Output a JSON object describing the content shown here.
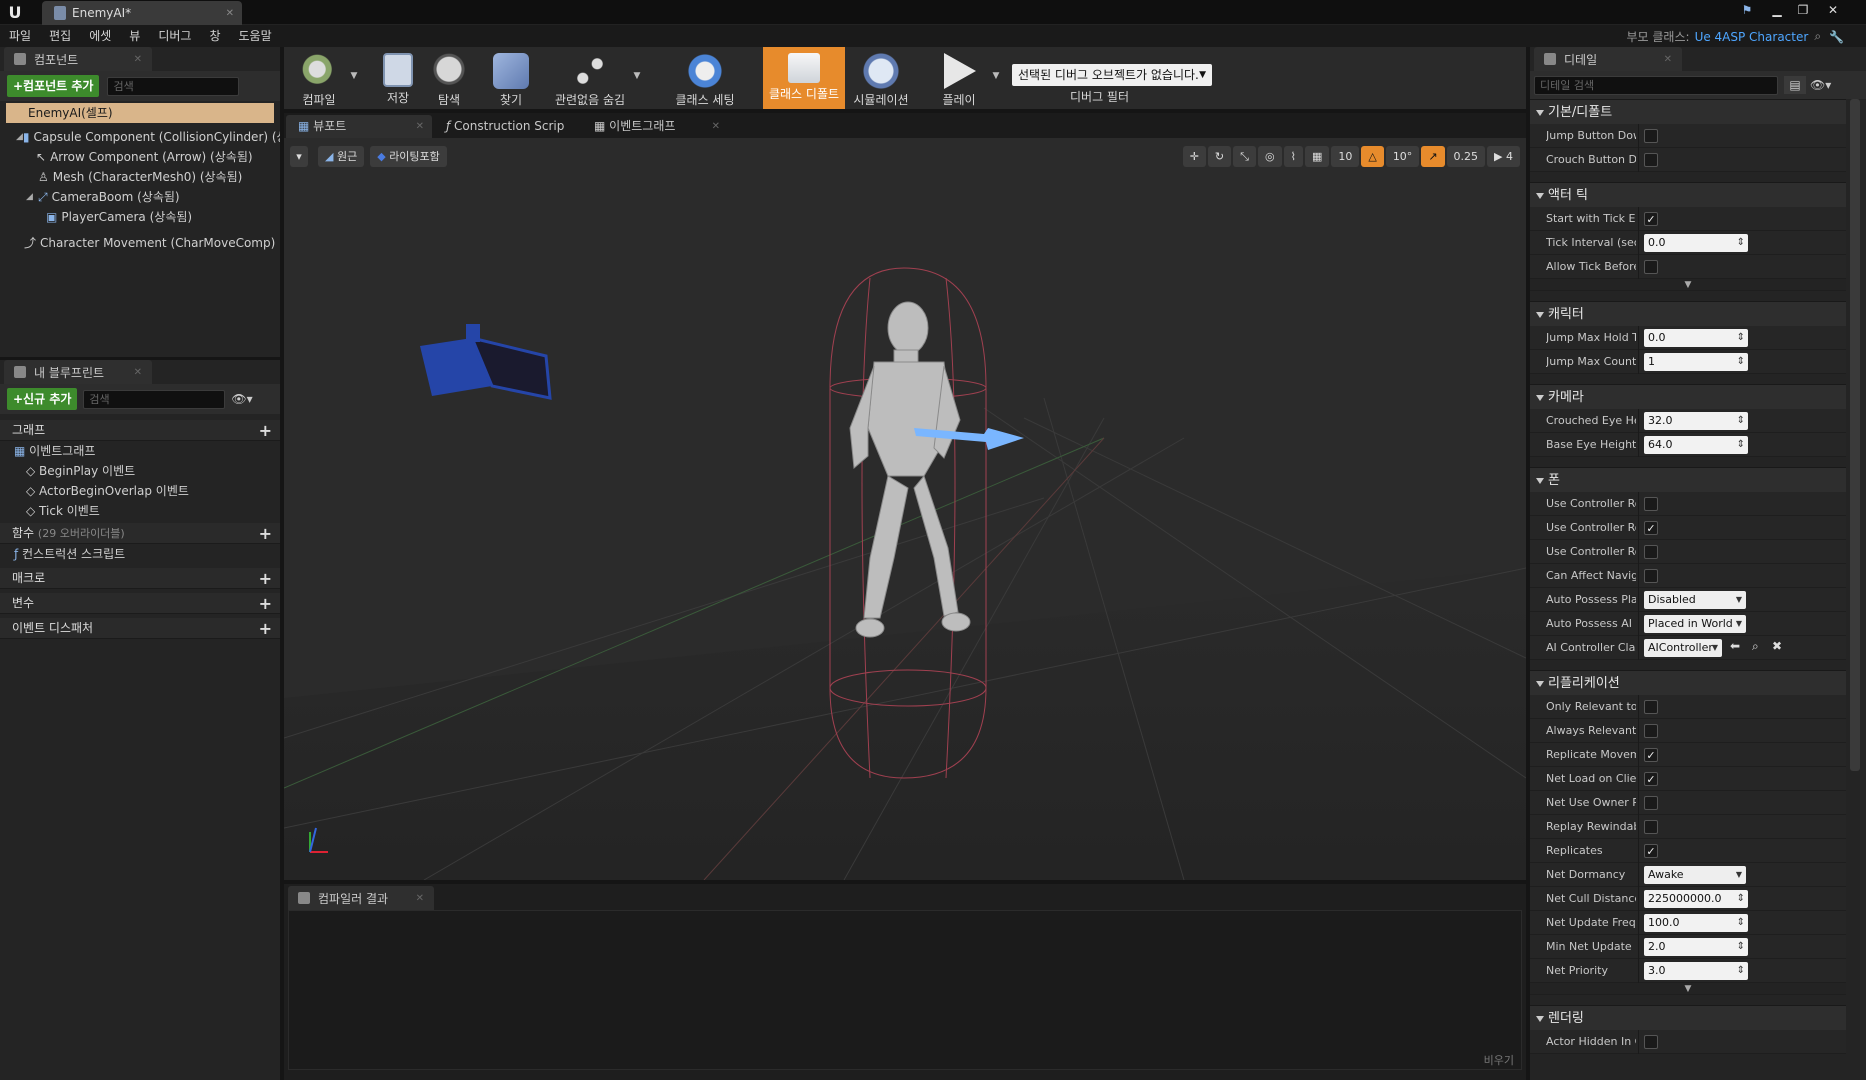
{
  "title_bar": {
    "logo": "U",
    "doc_tab": "EnemyAI*"
  },
  "menubar": {
    "items": [
      "파일",
      "편집",
      "에셋",
      "뷰",
      "디버그",
      "창",
      "도움말"
    ],
    "parent_class_label": "부모 클래스:",
    "parent_class_value": "Ue 4ASP Character"
  },
  "components": {
    "tab": "컴포넌트",
    "add_button": "+컴포넌트 추가",
    "search_placeholder": "검색",
    "root": "EnemyAI(셀프)",
    "items": [
      {
        "label": "Capsule Component (CollisionCylinder) (상",
        "indent": 1,
        "arrow": "◢"
      },
      {
        "label": "Arrow Component (Arrow) (상속됨)",
        "indent": 2,
        "arrow": ""
      },
      {
        "label": "Mesh (CharacterMesh0) (상속됨)",
        "indent": 2,
        "arrow": ""
      },
      {
        "label": "CameraBoom (상속됨)",
        "indent": 2,
        "arrow": "◢"
      },
      {
        "label": "PlayerCamera (상속됨)",
        "indent": 3,
        "arrow": ""
      },
      {
        "label": "Character Movement (CharMoveComp) (상",
        "indent": 1,
        "arrow": ""
      }
    ]
  },
  "my_blueprint": {
    "tab": "내 블루프린트",
    "add_button": "+신규 추가",
    "search_placeholder": "검색",
    "graphs_header": "그래프",
    "event_graph": "이벤트그래프",
    "events": [
      "BeginPlay 이벤트",
      "ActorBeginOverlap 이벤트",
      "Tick 이벤트"
    ],
    "functions_header": "함수",
    "functions_count": "(29 오버라이더블)",
    "construction_script": "컨스트럭션 스크립트",
    "macros": "매크로",
    "variables": "변수",
    "dispatchers": "이벤트 디스패처"
  },
  "toolbar": {
    "buttons": [
      "컴파일",
      "저장",
      "탐색",
      "찾기",
      "관련없음 숨김",
      "클래스 세팅",
      "클래스 디폴트",
      "시뮬레이션",
      "플레이"
    ],
    "debug_select": "선택된 디버그 오브젝트가 없습니다.",
    "debug_filter": "디버그 필터"
  },
  "editor_tabs": [
    "뷰포트",
    "Construction Scrip",
    "이벤트그래프"
  ],
  "viewport": {
    "perspective": "원근",
    "lighting": "라이팅포함",
    "grid_snap": "10",
    "rot_snap": "10°",
    "scale_snap": "0.25",
    "cam_speed": "4"
  },
  "compiler": {
    "tab": "컴파일러 결과",
    "clear": "비우기"
  },
  "details": {
    "tab": "디테일",
    "search_placeholder": "디테일 검색",
    "sections": [
      {
        "title": "기본/디폴트",
        "rows": [
          {
            "label": "Jump Button Down",
            "type": "check",
            "value": false
          },
          {
            "label": "Crouch Button Down",
            "type": "check",
            "value": false
          }
        ],
        "more": false
      },
      {
        "title": "액터 틱",
        "rows": [
          {
            "label": "Start with Tick Enabled",
            "type": "check",
            "value": true
          },
          {
            "label": "Tick Interval (secs)",
            "type": "num",
            "value": "0.0"
          },
          {
            "label": "Allow Tick Before Begin Play",
            "type": "check",
            "value": false
          }
        ],
        "more": true
      },
      {
        "title": "캐릭터",
        "rows": [
          {
            "label": "Jump Max Hold Time",
            "type": "num",
            "value": "0.0"
          },
          {
            "label": "Jump Max Count",
            "type": "num",
            "value": "1"
          }
        ],
        "more": false
      },
      {
        "title": "카메라",
        "rows": [
          {
            "label": "Crouched Eye Height",
            "type": "num",
            "value": "32.0"
          },
          {
            "label": "Base Eye Height",
            "type": "num",
            "value": "64.0"
          }
        ],
        "more": false
      },
      {
        "title": "폰",
        "rows": [
          {
            "label": "Use Controller Rotation Pitch",
            "type": "check",
            "value": false
          },
          {
            "label": "Use Controller Rotation Yaw",
            "type": "check",
            "value": true
          },
          {
            "label": "Use Controller Rotation Roll",
            "type": "check",
            "value": false
          },
          {
            "label": "Can Affect Navigation",
            "type": "check",
            "value": false
          },
          {
            "label": "Auto Possess Player",
            "type": "dd",
            "value": "Disabled"
          },
          {
            "label": "Auto Possess AI",
            "type": "dd",
            "value": "Placed in World"
          },
          {
            "label": "AI Controller Class",
            "type": "class",
            "value": "AIController"
          }
        ],
        "more": false
      },
      {
        "title": "리플리케이션",
        "rows": [
          {
            "label": "Only Relevant to Owner",
            "type": "check",
            "value": false
          },
          {
            "label": "Always Relevant",
            "type": "check",
            "value": false
          },
          {
            "label": "Replicate Movement",
            "type": "check",
            "value": true
          },
          {
            "label": "Net Load on Client",
            "type": "check",
            "value": true
          },
          {
            "label": "Net Use Owner Relevancy",
            "type": "check",
            "value": false
          },
          {
            "label": "Replay Rewindable",
            "type": "check",
            "value": false
          },
          {
            "label": "Replicates",
            "type": "check",
            "value": true
          },
          {
            "label": "Net Dormancy",
            "type": "dd",
            "value": "Awake"
          },
          {
            "label": "Net Cull Distance Squared",
            "type": "num",
            "value": "225000000.0"
          },
          {
            "label": "Net Update Frequency",
            "type": "num",
            "value": "100.0"
          },
          {
            "label": "Min Net Update Frequency",
            "type": "num",
            "value": "2.0"
          },
          {
            "label": "Net Priority",
            "type": "num",
            "value": "3.0"
          }
        ],
        "more": true
      },
      {
        "title": "렌더링",
        "rows": [
          {
            "label": "Actor Hidden In Game",
            "type": "check",
            "value": false
          }
        ],
        "more": false
      }
    ]
  }
}
